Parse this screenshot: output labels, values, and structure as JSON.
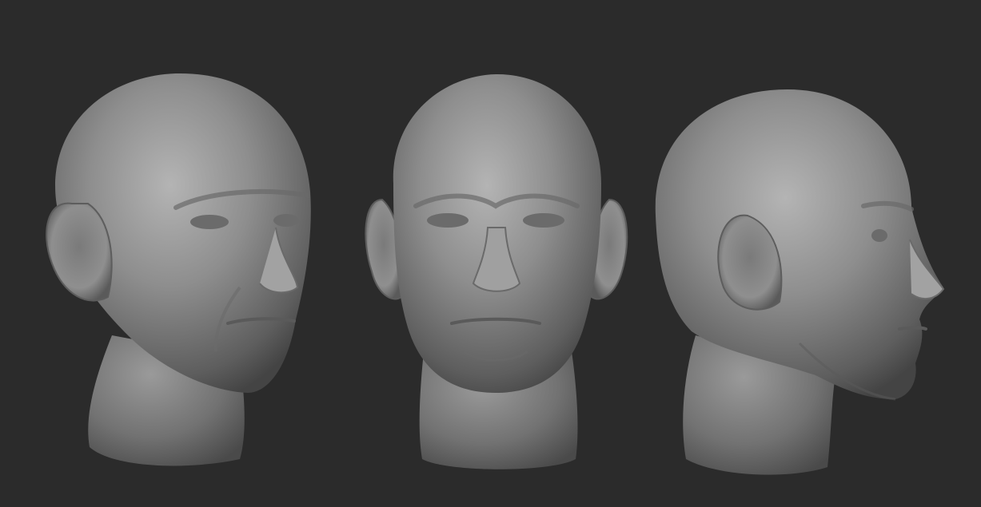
{
  "scene": {
    "background": "#2b2b2b",
    "clay_color": "#8c8c8c",
    "views": [
      {
        "name": "three-quarter-view"
      },
      {
        "name": "front-view"
      },
      {
        "name": "profile-view"
      }
    ]
  }
}
